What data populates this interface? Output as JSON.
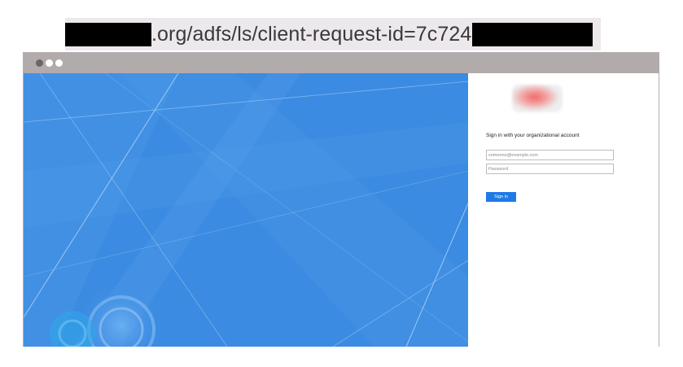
{
  "url_bar": {
    "visible_text": ".org/adfs/ls/client-request-id=7c724&"
  },
  "browser": {
    "window_controls": [
      "close-dot",
      "minimize-dot",
      "maximize-dot"
    ]
  },
  "illustration": {
    "background_color": "#3b8be2"
  },
  "signin": {
    "title": "Sign in with your organizational account",
    "email_placeholder": "someone@example.com",
    "password_placeholder": "Password",
    "button_label": "Sign in",
    "button_color": "#1f7ae6"
  }
}
